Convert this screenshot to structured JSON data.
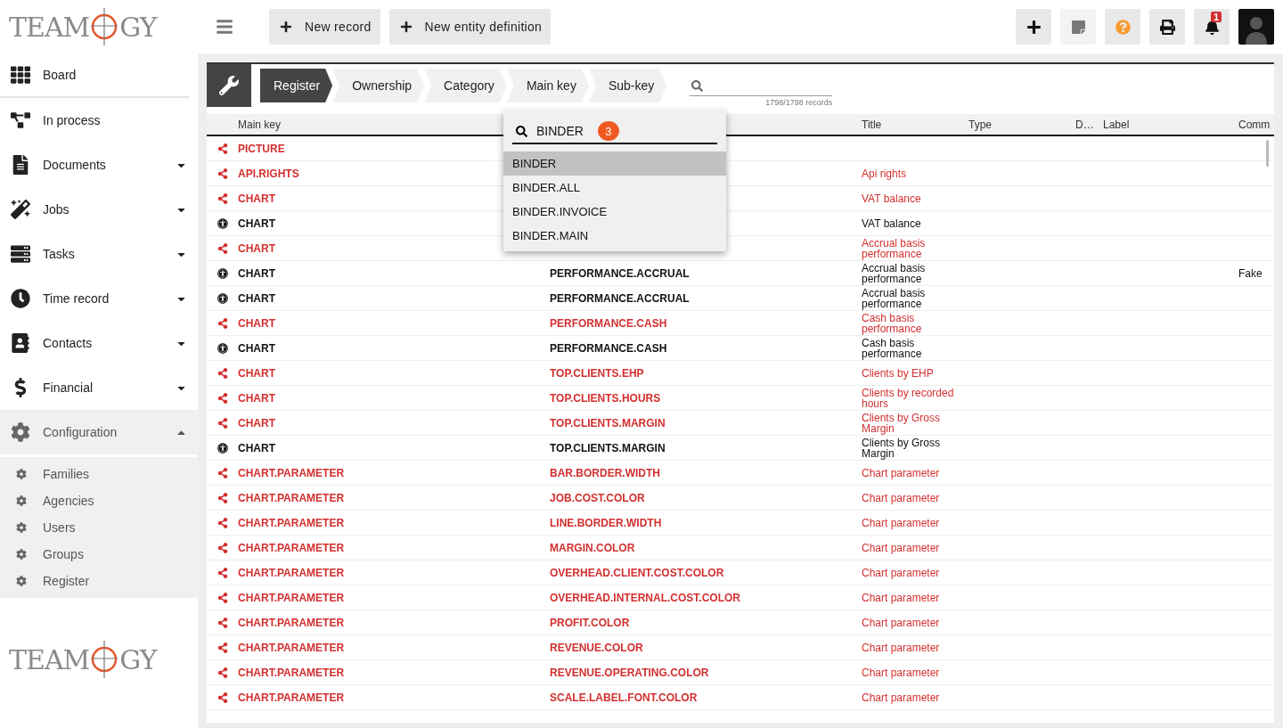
{
  "sidebar": {
    "logo": {
      "before": "TEAM",
      "after": "GY"
    },
    "items": [
      {
        "kind": "grid",
        "label": "Board"
      },
      {
        "kind": "flow",
        "label": "In process"
      },
      {
        "kind": "file",
        "label": "Documents",
        "expanded": false
      },
      {
        "kind": "jobs",
        "label": "Jobs",
        "expanded": false
      },
      {
        "kind": "tasks",
        "label": "Tasks",
        "expanded": false
      },
      {
        "kind": "clock",
        "label": "Time record",
        "expanded": false
      },
      {
        "kind": "contacts",
        "label": "Contacts",
        "expanded": false
      },
      {
        "kind": "dollar",
        "label": "Financial",
        "expanded": false
      },
      {
        "kind": "gear",
        "label": "Configuration",
        "expanded": true,
        "children": [
          {
            "label": "Families"
          },
          {
            "label": "Agencies"
          },
          {
            "label": "Users"
          },
          {
            "label": "Groups"
          },
          {
            "label": "Register"
          }
        ]
      }
    ],
    "footer_logo": {
      "before": "TEAM",
      "after": "GY"
    }
  },
  "toolbar": {
    "buttons": [
      {
        "label": "New record"
      },
      {
        "label": "New entity definition"
      }
    ],
    "icon_buttons": [
      {
        "kind": "plus"
      },
      {
        "kind": "note"
      },
      {
        "kind": "help"
      },
      {
        "kind": "print"
      },
      {
        "kind": "bell",
        "badge": "1"
      }
    ]
  },
  "breadcrumb": [
    {
      "label": "Register",
      "selected": true
    },
    {
      "label": "Ownership",
      "selected": false
    },
    {
      "label": "Category",
      "selected": false
    },
    {
      "label": "Main key",
      "selected": false
    },
    {
      "label": "Sub-key",
      "selected": false
    }
  ],
  "search": {
    "count": "1798/1798 records"
  },
  "table": {
    "columns": [
      "Main key",
      "Title",
      "Type",
      "D…",
      "Label",
      "Comm"
    ],
    "rows": [
      {
        "kind": "shared",
        "main_key": "PICTURE"
      },
      {
        "kind": "shared",
        "main_key": "API.RIGHTS",
        "title": "Api rights"
      },
      {
        "kind": "shared",
        "main_key": "CHART",
        "title": "VAT balance"
      },
      {
        "kind": "public",
        "main_key": "CHART",
        "title": "VAT balance"
      },
      {
        "kind": "shared",
        "main_key": "CHART",
        "title": "Accrual basis performance"
      },
      {
        "kind": "public",
        "main_key": "CHART",
        "sub_key": "PERFORMANCE.ACCRUAL",
        "title": "Accrual basis performance",
        "comment": "Fake"
      },
      {
        "kind": "public",
        "main_key": "CHART",
        "sub_key": "PERFORMANCE.ACCRUAL",
        "title": "Accrual basis performance"
      },
      {
        "kind": "shared",
        "main_key": "CHART",
        "sub_key": "PERFORMANCE.CASH",
        "title": "Cash basis performance"
      },
      {
        "kind": "public",
        "main_key": "CHART",
        "sub_key": "PERFORMANCE.CASH",
        "title": "Cash basis performance"
      },
      {
        "kind": "shared",
        "main_key": "CHART",
        "sub_key": "TOP.CLIENTS.EHP",
        "title": "Clients by EHP"
      },
      {
        "kind": "shared",
        "main_key": "CHART",
        "sub_key": "TOP.CLIENTS.HOURS",
        "title": "Clients by recorded hours"
      },
      {
        "kind": "shared",
        "main_key": "CHART",
        "sub_key": "TOP.CLIENTS.MARGIN",
        "title": "Clients by Gross Margin"
      },
      {
        "kind": "public",
        "main_key": "CHART",
        "sub_key": "TOP.CLIENTS.MARGIN",
        "title": "Clients by Gross Margin"
      },
      {
        "kind": "shared",
        "main_key": "CHART.PARAMETER",
        "sub_key": "BAR.BORDER.WIDTH",
        "title": "Chart parameter"
      },
      {
        "kind": "shared",
        "main_key": "CHART.PARAMETER",
        "sub_key": "JOB.COST.COLOR",
        "title": "Chart parameter"
      },
      {
        "kind": "shared",
        "main_key": "CHART.PARAMETER",
        "sub_key": "LINE.BORDER.WIDTH",
        "title": "Chart parameter"
      },
      {
        "kind": "shared",
        "main_key": "CHART.PARAMETER",
        "sub_key": "MARGIN.COLOR",
        "title": "Chart parameter"
      },
      {
        "kind": "shared",
        "main_key": "CHART.PARAMETER",
        "sub_key": "OVERHEAD.CLIENT.COST.COLOR",
        "title": "Chart parameter"
      },
      {
        "kind": "shared",
        "main_key": "CHART.PARAMETER",
        "sub_key": "OVERHEAD.INTERNAL.COST.COLOR",
        "title": "Chart parameter"
      },
      {
        "kind": "shared",
        "main_key": "CHART.PARAMETER",
        "sub_key": "PROFIT.COLOR",
        "title": "Chart parameter"
      },
      {
        "kind": "shared",
        "main_key": "CHART.PARAMETER",
        "sub_key": "REVENUE.COLOR",
        "title": "Chart parameter"
      },
      {
        "kind": "shared",
        "main_key": "CHART.PARAMETER",
        "sub_key": "REVENUE.OPERATING.COLOR",
        "title": "Chart parameter"
      },
      {
        "kind": "shared",
        "main_key": "CHART.PARAMETER",
        "sub_key": "SCALE.LABEL.FONT.COLOR",
        "title": "Chart parameter"
      }
    ]
  },
  "dropdown": {
    "value": "BINDER",
    "count": "3",
    "options": [
      {
        "label": "BINDER",
        "selected": true
      },
      {
        "label": "BINDER.ALL",
        "selected": false
      },
      {
        "label": "BINDER.INVOICE",
        "selected": false
      },
      {
        "label": "BINDER.MAIN",
        "selected": false
      }
    ]
  }
}
